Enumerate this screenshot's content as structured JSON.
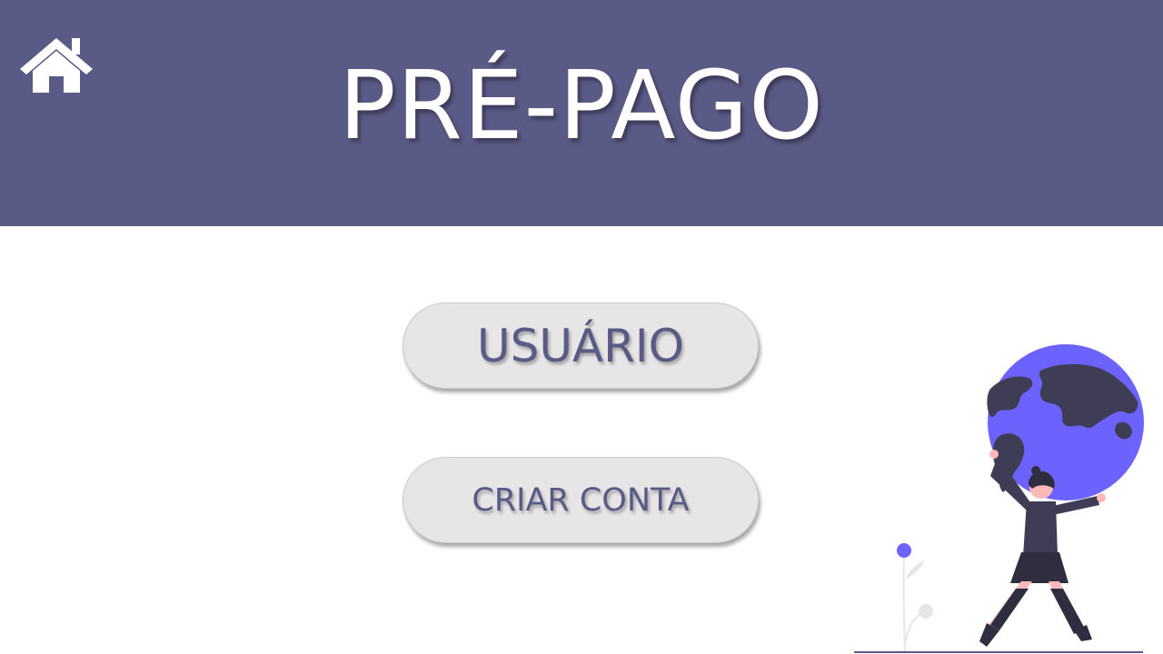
{
  "header": {
    "title": "PRÉ-PAGO",
    "background_color": "#5a5a87",
    "home_icon": "home-icon"
  },
  "buttons": {
    "user_label": "USUÁRIO",
    "create_account_label": "CRIAR CONTA",
    "text_color": "#5a5a87",
    "background_color": "#e6e6e6"
  },
  "illustration": {
    "name": "person-holding-globe-illustration",
    "globe_color": "#6c63ff"
  }
}
